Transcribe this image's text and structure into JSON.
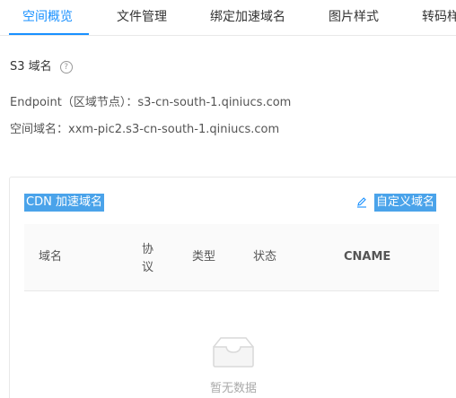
{
  "tabs": [
    {
      "label": "空间概览",
      "active": true
    },
    {
      "label": "文件管理",
      "active": false
    },
    {
      "label": "绑定加速域名",
      "active": false
    },
    {
      "label": "图片样式",
      "active": false
    },
    {
      "label": "转码样",
      "active": false
    }
  ],
  "s3": {
    "title": "S3 域名",
    "help_icon": "?",
    "endpoint_label": "Endpoint（区域节点）：",
    "endpoint_value": "s3-cn-south-1.qiniucs.com",
    "space_domain_label": "空间域名：",
    "space_domain_value": "xxm-pic2.s3-cn-south-1.qiniucs.com"
  },
  "cdn": {
    "title": "CDN 加速域名",
    "custom_domain_label": "自定义域名",
    "columns": [
      "域名",
      "协议",
      "类型",
      "状态",
      "CNAME"
    ],
    "empty_text": "暂无数据"
  },
  "colors": {
    "accent": "#1890ff",
    "highlight": "#4aa3ea"
  }
}
